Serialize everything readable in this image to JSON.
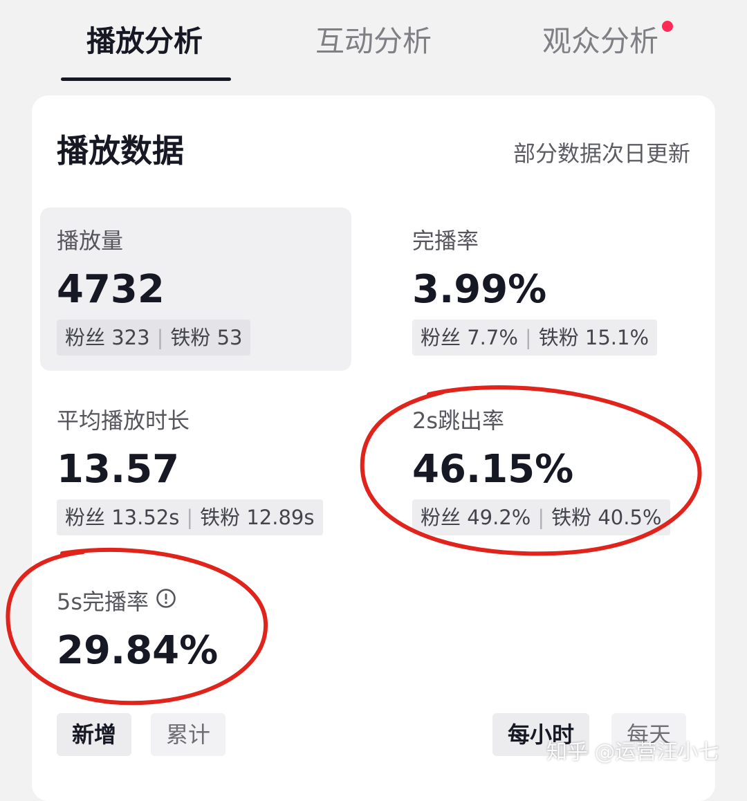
{
  "tabs": [
    {
      "label": "播放分析",
      "active": true
    },
    {
      "label": "互动分析",
      "active": false
    },
    {
      "label": "观众分析",
      "active": false,
      "has_dot": true
    }
  ],
  "card": {
    "title": "播放数据",
    "note": "部分数据次日更新"
  },
  "metrics": {
    "plays": {
      "label": "播放量",
      "value": "4732",
      "fans": "粉丝 323",
      "iron_fans": "铁粉 53"
    },
    "completion": {
      "label": "完播率",
      "value": "3.99%",
      "fans": "粉丝 7.7%",
      "iron_fans": "铁粉 15.1%"
    },
    "avg_duration": {
      "label": "平均播放时长",
      "value": "13.57",
      "fans": "粉丝 13.52s",
      "iron_fans": "铁粉 12.89s"
    },
    "bounce_2s": {
      "label": "2s跳出率",
      "value": "46.15%",
      "fans": "粉丝 49.2%",
      "iron_fans": "铁粉 40.5%"
    },
    "completion_5s": {
      "label": "5s完播率",
      "value": "29.84%"
    }
  },
  "toggles": {
    "left": [
      {
        "label": "新增",
        "active": true
      },
      {
        "label": "累计",
        "active": false
      }
    ],
    "right": [
      {
        "label": "每小时",
        "active": true
      },
      {
        "label": "每天",
        "active": false
      }
    ]
  },
  "icons": {
    "info": "info-circle-icon"
  },
  "colors": {
    "accent_dot": "#fe2c55",
    "annotation": "#e0231b"
  },
  "watermark": "知乎 @运营汪小七"
}
